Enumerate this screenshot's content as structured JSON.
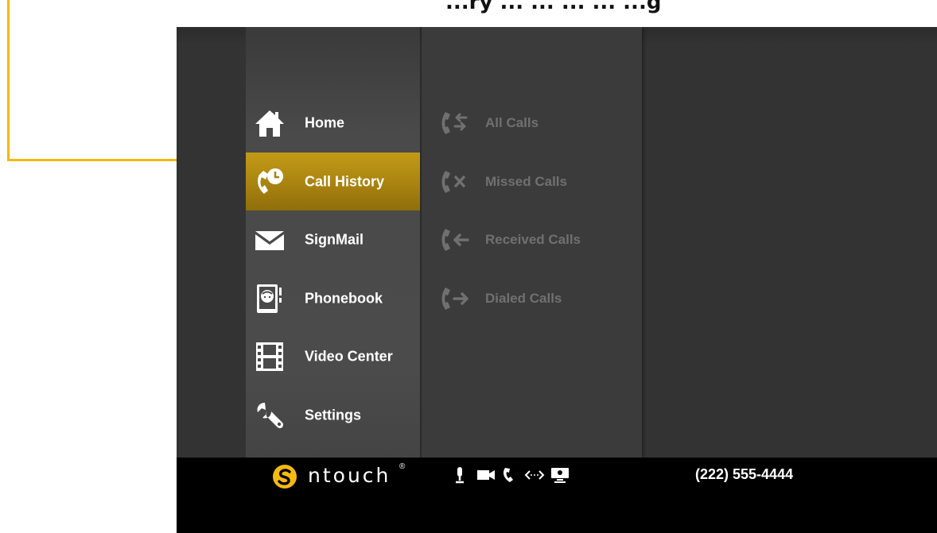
{
  "heading": "...ry ... ... ... ... ...g",
  "menu": {
    "items": [
      {
        "label": "Home",
        "icon": "home-icon",
        "selected": false
      },
      {
        "label": "Call History",
        "icon": "call-history-icon",
        "selected": true
      },
      {
        "label": "SignMail",
        "icon": "envelope-icon",
        "selected": false
      },
      {
        "label": "Phonebook",
        "icon": "phonebook-icon",
        "selected": false
      },
      {
        "label": "Video Center",
        "icon": "film-icon",
        "selected": false
      },
      {
        "label": "Settings",
        "icon": "wrench-icon",
        "selected": false
      }
    ]
  },
  "submenu": {
    "items": [
      {
        "label": "All Calls",
        "icon": "all-calls-icon"
      },
      {
        "label": "Missed Calls",
        "icon": "missed-calls-icon"
      },
      {
        "label": "Received Calls",
        "icon": "received-calls-icon"
      },
      {
        "label": "Dialed Calls",
        "icon": "dialed-calls-icon"
      }
    ]
  },
  "status_bar": {
    "logo_text": "ntouch",
    "logo_mark": "®",
    "phone_number": "(222) 555-4444",
    "icons": [
      "microphone-icon",
      "video-camera-icon",
      "phone-icon",
      "network-icon",
      "monitor-icon"
    ]
  },
  "colors": {
    "accent": "#f5b90f",
    "selected_item": "#a98310",
    "screen_bg": "#333333",
    "menu_bg": "#4a4a4a",
    "submenu_text": "#707070",
    "bar_bg": "#000000"
  }
}
